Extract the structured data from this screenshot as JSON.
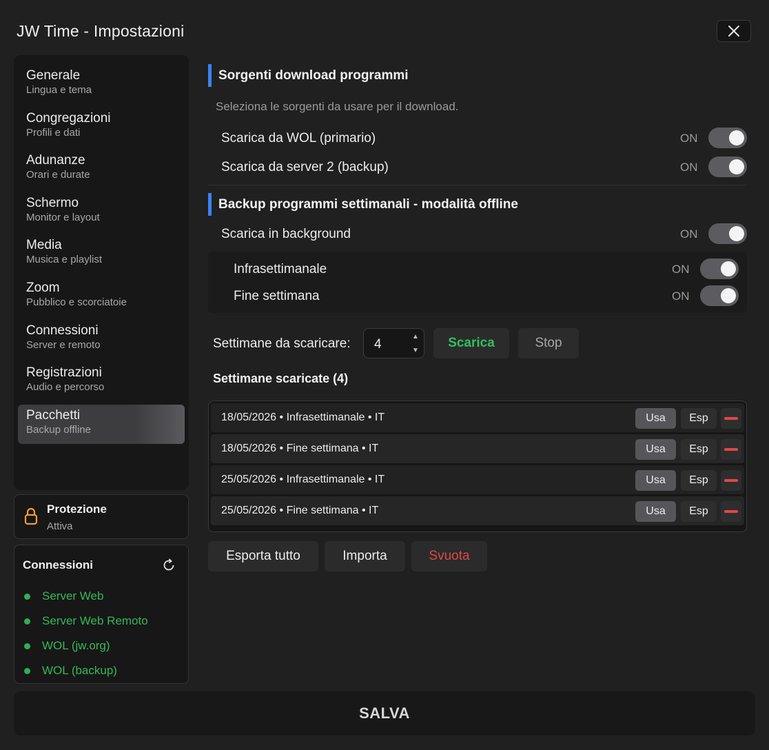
{
  "window": {
    "title": "JW Time - Impostazioni"
  },
  "sidebar": {
    "items": [
      {
        "title": "Generale",
        "subtitle": "Lingua e tema"
      },
      {
        "title": "Congregazioni",
        "subtitle": "Profili e dati"
      },
      {
        "title": "Adunanze",
        "subtitle": "Orari e durate"
      },
      {
        "title": "Schermo",
        "subtitle": "Monitor e layout"
      },
      {
        "title": "Media",
        "subtitle": "Musica e playlist"
      },
      {
        "title": "Zoom",
        "subtitle": "Pubblico e scorciatoie"
      },
      {
        "title": "Connessioni",
        "subtitle": "Server e remoto"
      },
      {
        "title": "Registrazioni",
        "subtitle": "Audio e percorso"
      },
      {
        "title": "Pacchetti",
        "subtitle": "Backup offline"
      }
    ],
    "active": "Pacchetti"
  },
  "protection": {
    "title": "Protezione",
    "status": "Attiva"
  },
  "connections": {
    "title": "Connessioni",
    "items": [
      "Server Web",
      "Server Web Remoto",
      "WOL (jw.org)",
      "WOL (backup)"
    ],
    "status_color": "#2fae55"
  },
  "sources": {
    "heading": "Sorgenti download programmi",
    "hint": "Seleziona le sorgenti da usare per il download.",
    "wol": {
      "label": "Scarica da WOL (primario)",
      "state": "ON"
    },
    "server2": {
      "label": "Scarica da server 2 (backup)",
      "state": "ON"
    }
  },
  "backup": {
    "heading": "Backup programmi settimanali - modalità offline",
    "background": {
      "label": "Scarica in background",
      "state": "ON"
    },
    "midweek": {
      "label": "Infrasettimanale",
      "state": "ON"
    },
    "weekend": {
      "label": "Fine settimana",
      "state": "ON"
    },
    "weeks_label": "Settimane da scaricare:",
    "weeks_value": "4",
    "download_button": "Scarica",
    "stop_button": "Stop",
    "downloaded_title": "Settimane scaricate (4)",
    "rows": [
      {
        "text": "18/05/2026 • Infrasettimanale • IT",
        "use": "Usa",
        "export": "Esp"
      },
      {
        "text": "18/05/2026 • Fine settimana • IT",
        "use": "Usa",
        "export": "Esp"
      },
      {
        "text": "25/05/2026 • Infrasettimanale • IT",
        "use": "Usa",
        "export": "Esp"
      },
      {
        "text": "25/05/2026 • Fine settimana • IT",
        "use": "Usa",
        "export": "Esp"
      }
    ],
    "export_all": "Esporta tutto",
    "import": "Importa",
    "clear": "Svuota"
  },
  "footer": {
    "save": "SALVA"
  },
  "colors": {
    "accent": "#3b82f6",
    "success": "#2fae55",
    "danger": "#e04848"
  }
}
